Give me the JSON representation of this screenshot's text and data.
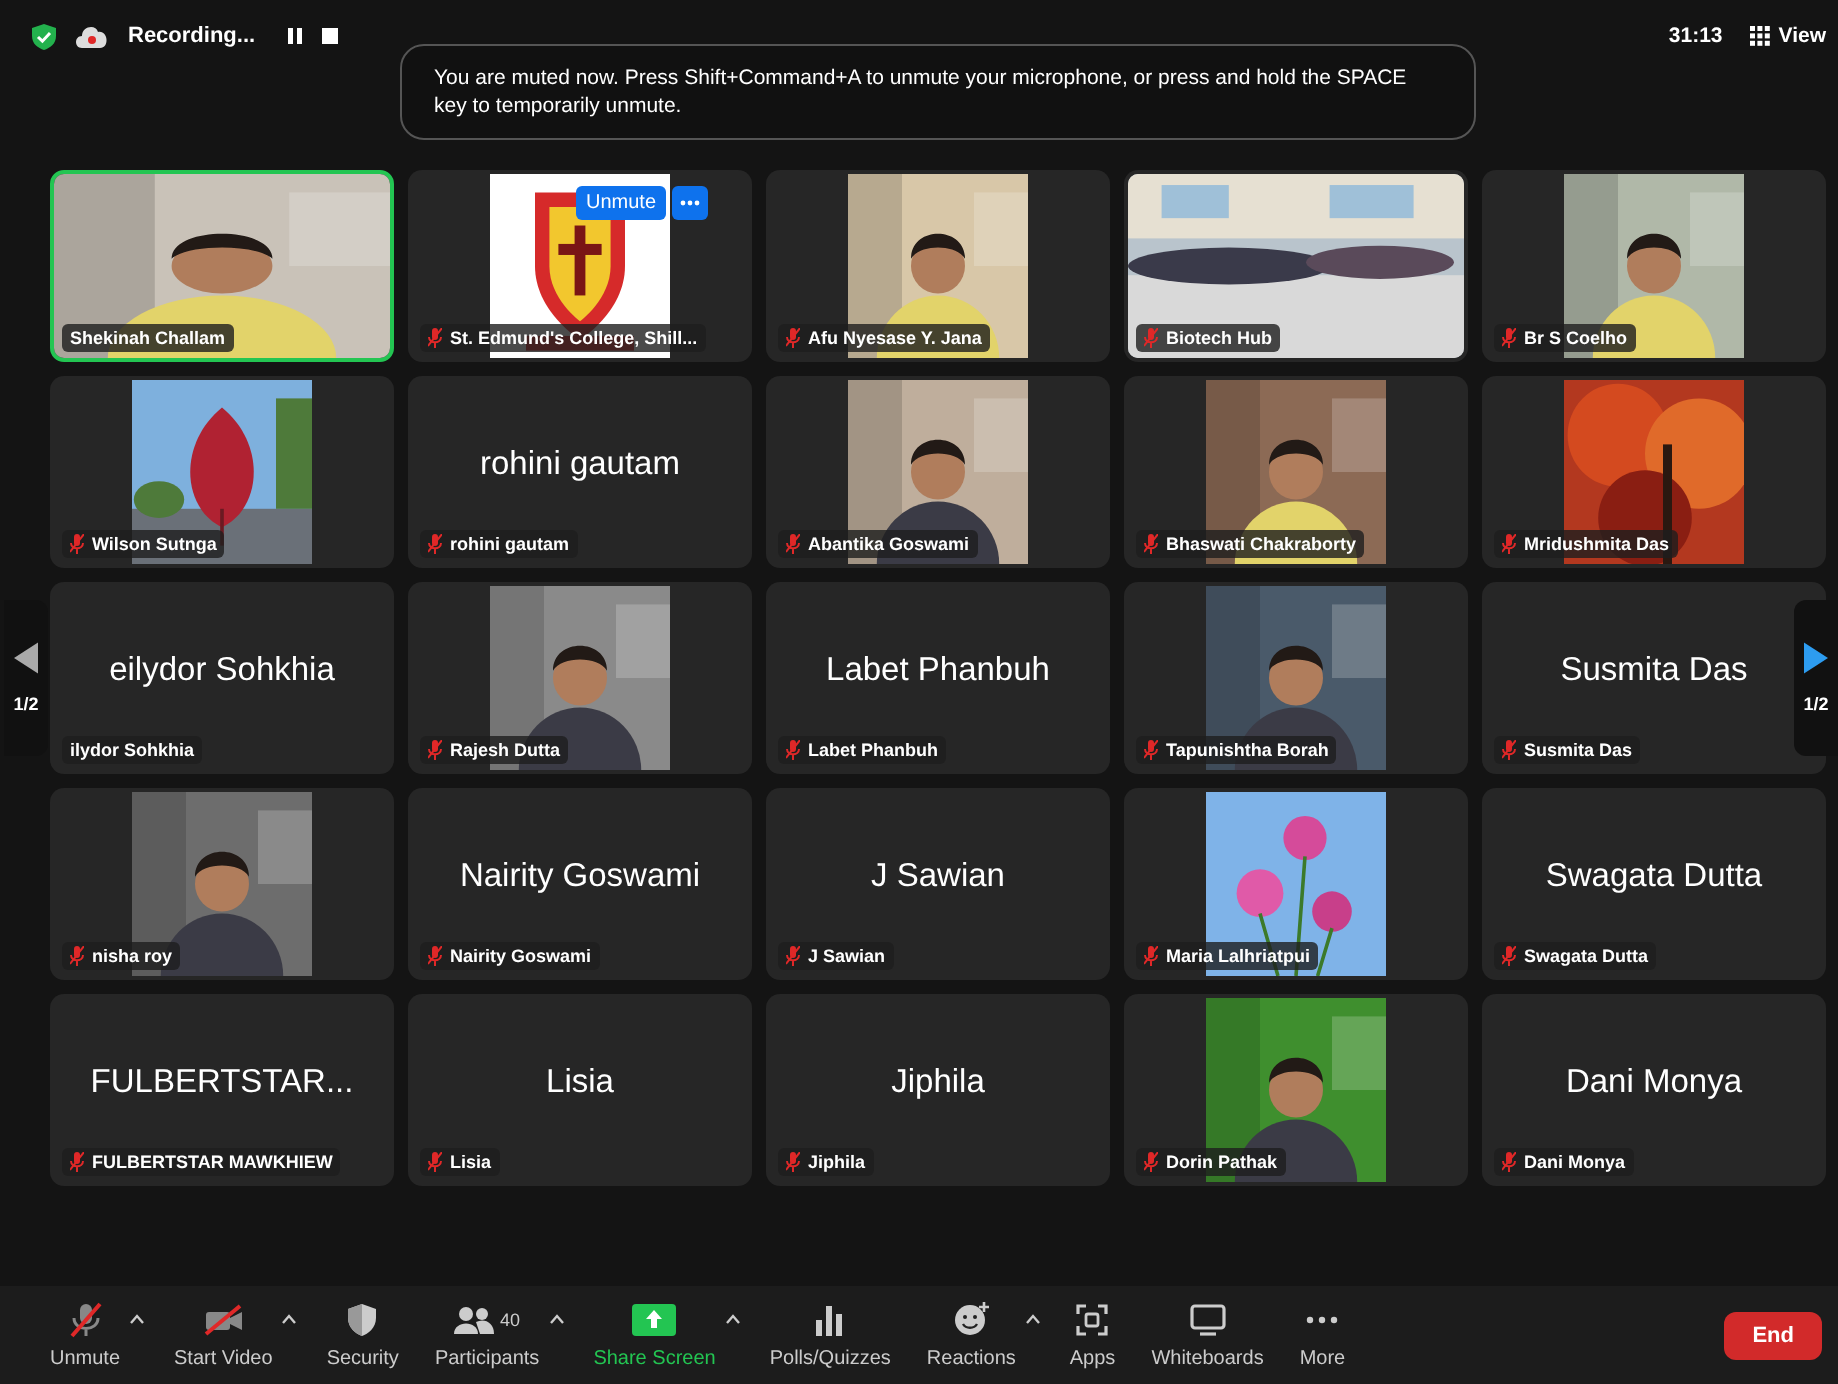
{
  "top_bar": {
    "recording_label": "Recording...",
    "timer": "31:13",
    "view_button": "View"
  },
  "notice": "You are muted now. Press Shift+Command+A to unmute your microphone, or press and hold the SPACE key to temporarily unmute.",
  "tiles": [
    {
      "kind": "picture",
      "label": "Shekinah Challam",
      "muted": false,
      "active": true
    },
    {
      "kind": "picture",
      "label": "St. Edmund's College, Shill...",
      "muted": true,
      "active": false,
      "unmute_button": "Unmute"
    },
    {
      "kind": "picture",
      "label": "Afu Nyesase Y. Jana",
      "muted": true,
      "active": false
    },
    {
      "kind": "picture",
      "label": "Biotech Hub",
      "muted": true,
      "active": false
    },
    {
      "kind": "picture",
      "label": "Br S Coelho",
      "muted": true,
      "active": false
    },
    {
      "kind": "picture",
      "label": "Wilson Sutnga",
      "muted": true,
      "active": false
    },
    {
      "kind": "name",
      "name": "rohini gautam",
      "label": "rohini gautam",
      "muted": true,
      "active": false
    },
    {
      "kind": "picture",
      "label": "Abantika Goswami",
      "muted": true,
      "active": false
    },
    {
      "kind": "picture",
      "label": "Bhaswati Chakraborty",
      "muted": true,
      "active": false
    },
    {
      "kind": "picture",
      "label": "Mridushmita Das",
      "muted": true,
      "active": false
    },
    {
      "kind": "name",
      "name": "eilydor Sohkhia",
      "label": "ilydor Sohkhia",
      "muted": false,
      "active": false
    },
    {
      "kind": "picture",
      "label": "Rajesh Dutta",
      "muted": true,
      "active": false
    },
    {
      "kind": "name",
      "name": "Labet Phanbuh",
      "label": "Labet Phanbuh",
      "muted": true,
      "active": false
    },
    {
      "kind": "picture",
      "label": "Tapunishtha Borah",
      "muted": true,
      "active": false
    },
    {
      "kind": "name",
      "name": "Susmita Das",
      "label": "Susmita Das",
      "muted": true,
      "active": false
    },
    {
      "kind": "picture",
      "label": "nisha roy",
      "muted": true,
      "active": false
    },
    {
      "kind": "name",
      "name": "Nairity Goswami",
      "label": "Nairity Goswami",
      "muted": true,
      "active": false
    },
    {
      "kind": "name",
      "name": "J Sawian",
      "label": "J Sawian",
      "muted": true,
      "active": false
    },
    {
      "kind": "picture",
      "label": "Maria Lalhriatpui",
      "muted": true,
      "active": false
    },
    {
      "kind": "name",
      "name": "Swagata Dutta",
      "label": "Swagata Dutta",
      "muted": true,
      "active": false
    },
    {
      "kind": "name",
      "name": "FULBERTSTAR...",
      "label": "FULBERTSTAR MAWKHIEW",
      "muted": true,
      "active": false
    },
    {
      "kind": "name",
      "name": "Lisia",
      "label": "Lisia",
      "muted": true,
      "active": false
    },
    {
      "kind": "name",
      "name": "Jiphila",
      "label": "Jiphila",
      "muted": true,
      "active": false
    },
    {
      "kind": "picture",
      "label": "Dorin Pathak",
      "muted": true,
      "active": false
    },
    {
      "kind": "name",
      "name": "Dani Monya",
      "label": "Dani Monya",
      "muted": true,
      "active": false
    }
  ],
  "pager": {
    "previous_page": "1/2",
    "next_page": "1/2"
  },
  "toolbar": [
    {
      "kind": "mic",
      "label": "Unmute",
      "caret": true
    },
    {
      "kind": "video",
      "label": "Start Video",
      "caret": true
    },
    {
      "kind": "security",
      "label": "Security",
      "caret": false
    },
    {
      "kind": "participants",
      "label": "Participants",
      "count": "40",
      "caret": true
    },
    {
      "kind": "share",
      "label": "Share Screen",
      "caret": true
    },
    {
      "kind": "polls",
      "label": "Polls/Quizzes",
      "caret": false
    },
    {
      "kind": "reactions",
      "label": "Reactions",
      "caret": true
    },
    {
      "kind": "apps",
      "label": "Apps",
      "caret": false
    },
    {
      "kind": "whiteboards",
      "label": "Whiteboards",
      "caret": false
    },
    {
      "kind": "more",
      "label": "More",
      "caret": false
    }
  ],
  "end_button": "End"
}
